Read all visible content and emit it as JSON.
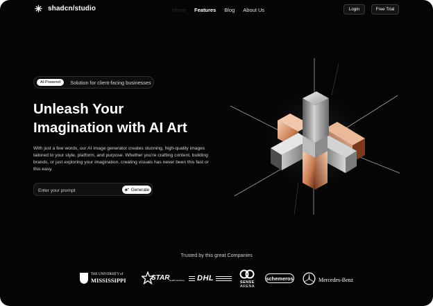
{
  "brand": {
    "name": "shadcn/studio",
    "logo_icon": "asterisk-logo-icon"
  },
  "nav": {
    "links": [
      {
        "label": "Home",
        "state": "dim"
      },
      {
        "label": "Features",
        "state": "bold"
      },
      {
        "label": "Blog",
        "state": "normal"
      },
      {
        "label": "About Us",
        "state": "normal"
      }
    ],
    "login": "Login",
    "free_trial": "Free Trial"
  },
  "hero": {
    "badge": "AI-Powered",
    "tagline": "Solution for client-facing businesses",
    "headline_line1": "Unleash Your",
    "headline_line2": "Imagination with AI Art",
    "description": "With just a few words, our AI image generator creates stunning, high-quality images tailored to your style, platform, and purpose. Whether you're crafting content, building brands, or just exploring your imagination, creating visuals has never been this fast or this easy.",
    "prompt_placeholder": "Enter your prompt",
    "generate_label": "Generate",
    "generate_icon": "sparkles-icon"
  },
  "companies": {
    "heading": "Trusted by this great Companies",
    "items": [
      {
        "name": "University of Mississippi",
        "line1": "THE UNIVERSITY of",
        "line2": "MISSISSIPPI",
        "icon": "ole-miss-shield-icon"
      },
      {
        "name": "Star",
        "line1": "STAR",
        "line2": "Health Solutions",
        "icon": "star-icon"
      },
      {
        "name": "DHL",
        "line1": "DHL"
      },
      {
        "name": "Sense Arena",
        "line1": "SENSE",
        "line2": "ARENA",
        "icon": "sense-arena-icon"
      },
      {
        "name": "Schemeros",
        "line1": "schemeros"
      },
      {
        "name": "Mercedes-Benz",
        "line1": "Mercedes-Benz",
        "icon": "mercedes-star-icon"
      }
    ]
  },
  "colors": {
    "background": "#050505",
    "text": "#ffffff",
    "muted": "#d6d6d6",
    "accent_glow": "#d98a5a"
  }
}
